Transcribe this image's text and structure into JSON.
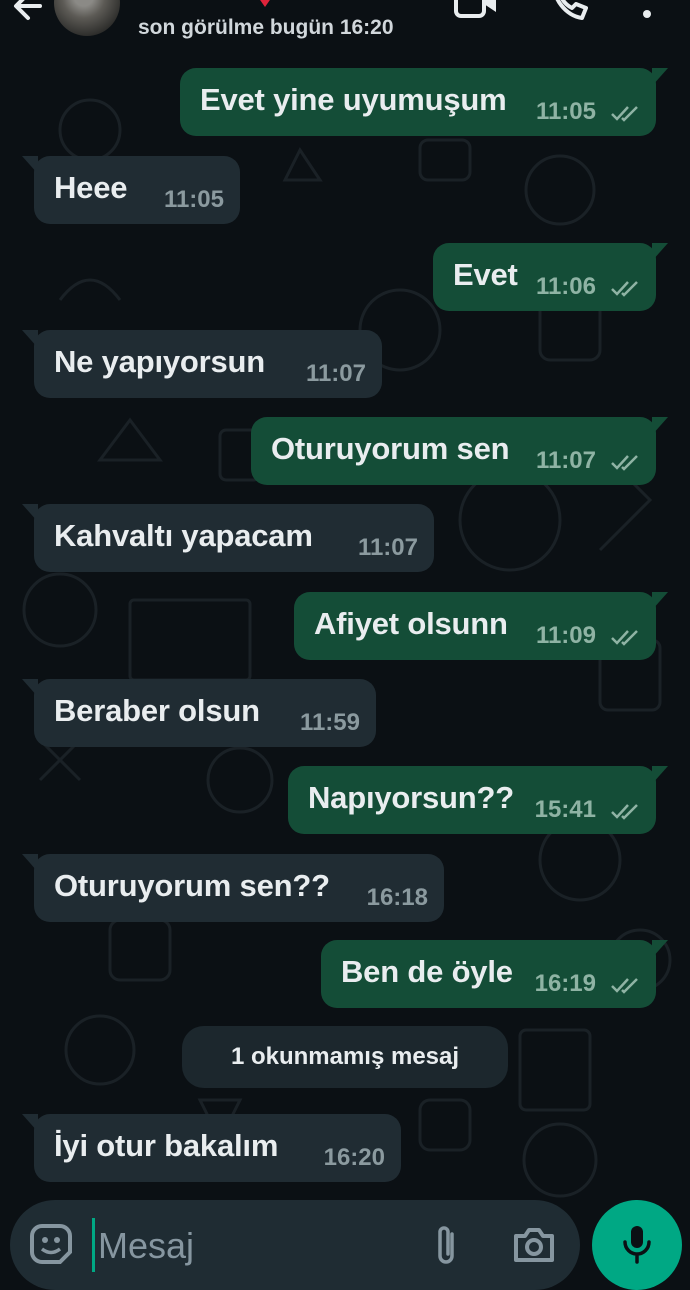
{
  "header": {
    "status": "son görülme bugün 16:20"
  },
  "messages": [
    {
      "dir": "out",
      "text": "Evet yine uyumuşum",
      "time": "11:05"
    },
    {
      "dir": "in",
      "text": "Heee",
      "time": "11:05"
    },
    {
      "dir": "out",
      "text": "Evet",
      "time": "11:06"
    },
    {
      "dir": "in",
      "text": "Ne yapıyorsun",
      "time": "11:07"
    },
    {
      "dir": "out",
      "text": "Oturuyorum sen",
      "time": "11:07"
    },
    {
      "dir": "in",
      "text": "Kahvaltı yapacam",
      "time": "11:07"
    },
    {
      "dir": "out",
      "text": "Afiyet olsunn",
      "time": "11:09"
    },
    {
      "dir": "in",
      "text": "Beraber olsun",
      "time": "11:59"
    },
    {
      "dir": "out",
      "text": "Napıyorsun??",
      "time": "15:41"
    },
    {
      "dir": "in",
      "text": "Oturuyorum sen??",
      "time": "16:18"
    },
    {
      "dir": "out",
      "text": "Ben de öyle",
      "time": "16:19"
    },
    {
      "dir": "in",
      "text": "İyi otur bakalım",
      "time": "16:20"
    }
  ],
  "unread_banner": "1 okunmamış mesaj",
  "composer": {
    "placeholder": "Mesaj"
  },
  "icons": {
    "back": "arrow-left-icon",
    "video": "video-camera-icon",
    "call": "phone-icon",
    "menu": "more-vertical-icon",
    "emoji": "sticker-icon",
    "attach": "paperclip-icon",
    "camera": "camera-icon",
    "mic": "microphone-icon",
    "read": "double-check-icon"
  },
  "colors": {
    "background": "#0b1014",
    "outgoing_bubble": "#144d37",
    "incoming_bubble": "#202c33",
    "accent": "#00a884"
  }
}
